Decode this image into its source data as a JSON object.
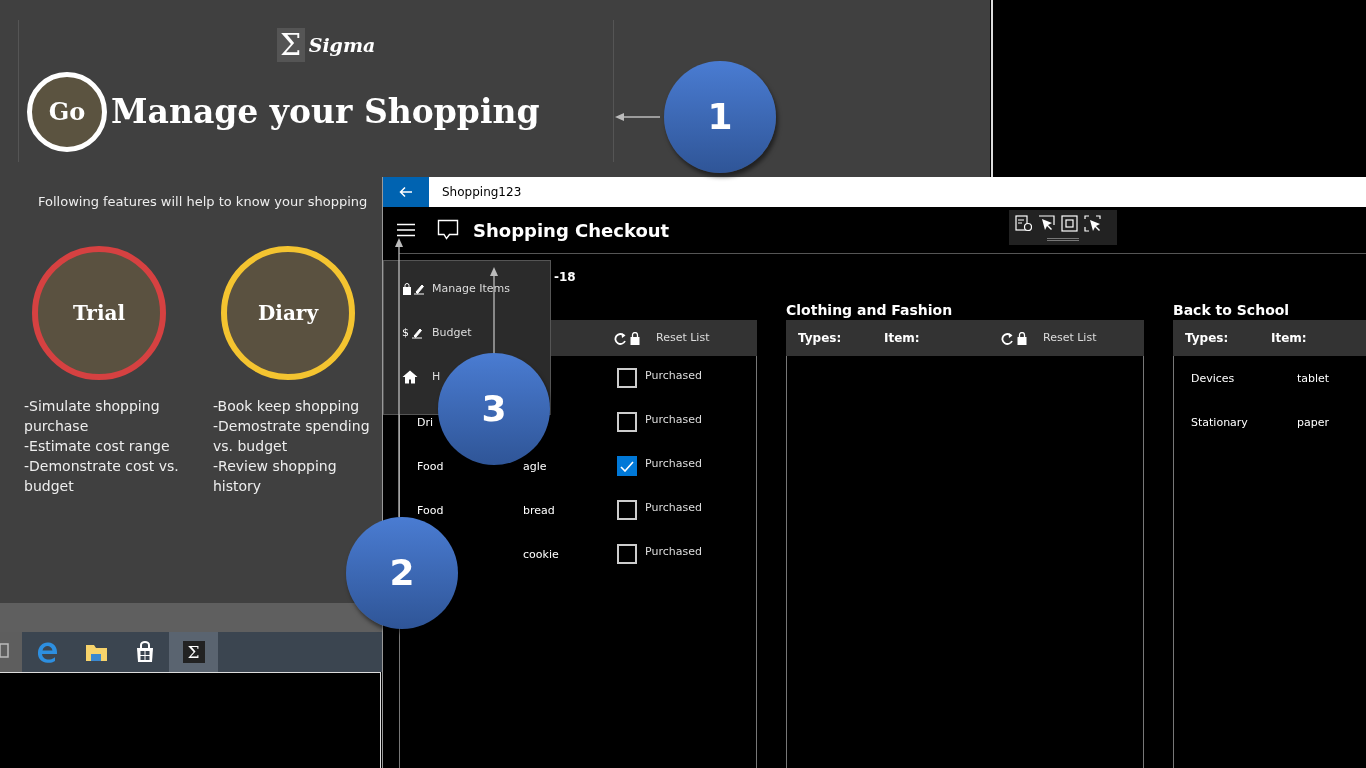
{
  "slide": {
    "logo": {
      "mark": "Σ",
      "name": "Sigma"
    },
    "go_badge": "Go",
    "heading": "Manage your Shopping",
    "subtitle": "Following features will help to know your shopping",
    "features": [
      {
        "label": "Trial",
        "color": "#d64141",
        "lines": [
          "-Simulate shopping purchase",
          "-Estimate cost range",
          "-Demonstrate cost vs. budget"
        ]
      },
      {
        "label": "Diary",
        "color": "#f4c430",
        "lines": [
          "-Book keep shopping",
          "-Demostrate spending vs. budget",
          "-Review shopping history"
        ]
      }
    ]
  },
  "taskbar": {
    "apps": [
      {
        "kind": "device",
        "selected": false
      },
      {
        "kind": "browser",
        "selected": false
      },
      {
        "kind": "folder",
        "selected": false
      },
      {
        "kind": "store",
        "selected": false
      },
      {
        "kind": "sigma",
        "glyph": "Σ",
        "selected": true
      }
    ]
  },
  "app": {
    "title": "Shopping123",
    "page_title": "Shopping Checkout",
    "date": "-18",
    "menu": [
      {
        "kind": "items",
        "label": "Manage Items"
      },
      {
        "kind": "budget",
        "symbol": "$",
        "label": "Budget"
      },
      {
        "kind": "home",
        "label": "H"
      }
    ],
    "lists": [
      {
        "reset_label": "Reset List",
        "rows": [
          {
            "purchased": false,
            "label": "Purchased"
          },
          {
            "type": "Dri",
            "purchased": false,
            "label": "Purchased"
          },
          {
            "type": "Food",
            "item": "agle",
            "purchased": true,
            "label": "Purchased"
          },
          {
            "type": "Food",
            "item": "bread",
            "purchased": false,
            "label": "Purchased"
          },
          {
            "item": "cookie",
            "purchased": false,
            "label": "Purchased"
          }
        ]
      },
      {
        "title": "Clothing and Fashion",
        "columns": [
          "Types:",
          "Item:"
        ],
        "reset_label": "Reset List"
      },
      {
        "title": "Back to School",
        "columns": [
          "Types:",
          "Item:"
        ],
        "rows": [
          {
            "type": "Devices",
            "item": "tablet"
          },
          {
            "type": "Stationary",
            "item": "paper"
          }
        ]
      }
    ]
  },
  "annotations": [
    {
      "number": "1"
    },
    {
      "number": "2"
    },
    {
      "number": "3"
    }
  ]
}
